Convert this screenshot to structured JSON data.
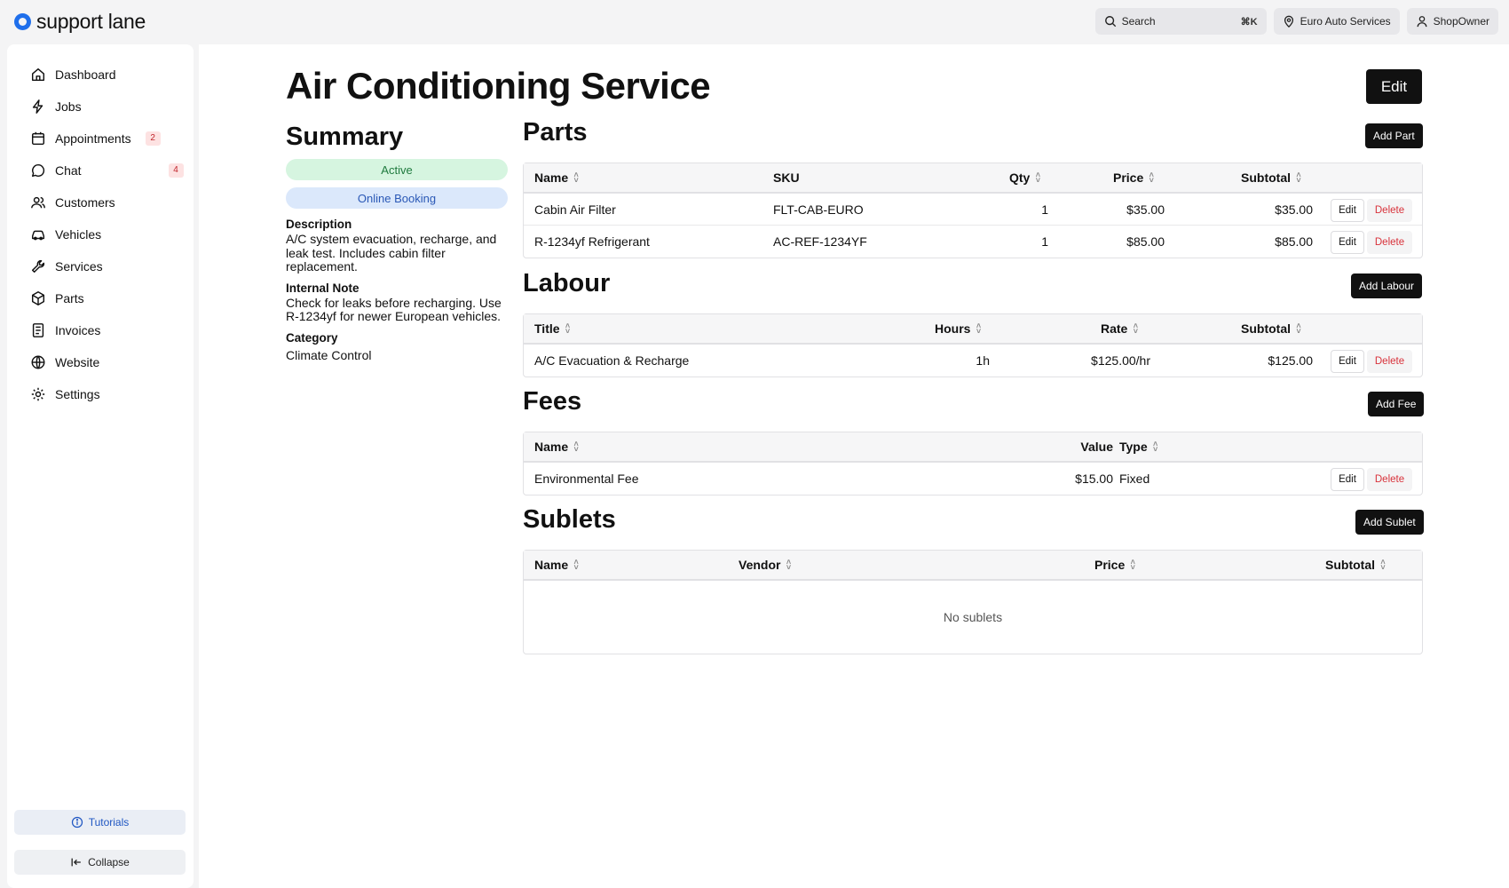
{
  "app": {
    "name": "support lane"
  },
  "topbar": {
    "search_label": "Search",
    "search_shortcut": "⌘K",
    "location": "Euro Auto Services",
    "user": "ShopOwner"
  },
  "sidebar": {
    "items": [
      {
        "label": "Dashboard",
        "icon": "home-icon"
      },
      {
        "label": "Jobs",
        "icon": "lightning-icon"
      },
      {
        "label": "Appointments",
        "icon": "calendar-icon",
        "badge": "2"
      },
      {
        "label": "Chat",
        "icon": "chat-icon",
        "badge": "4"
      },
      {
        "label": "Customers",
        "icon": "users-icon"
      },
      {
        "label": "Vehicles",
        "icon": "car-icon"
      },
      {
        "label": "Services",
        "icon": "wrench-icon"
      },
      {
        "label": "Parts",
        "icon": "box-icon"
      },
      {
        "label": "Invoices",
        "icon": "invoice-icon"
      },
      {
        "label": "Website",
        "icon": "globe-icon"
      },
      {
        "label": "Settings",
        "icon": "gear-icon"
      }
    ],
    "tutorials_label": "Tutorials",
    "collapse_label": "Collapse"
  },
  "page": {
    "title": "Air Conditioning Service",
    "edit_label": "Edit"
  },
  "summary": {
    "title": "Summary",
    "status_badge": "Active",
    "booking_badge": "Online Booking",
    "description_label": "Description",
    "description": "A/C system evacuation, recharge, and leak test. Includes cabin filter replacement.",
    "internal_note_label": "Internal Note",
    "internal_note": "Check for leaks before recharging. Use R-1234yf for newer European vehicles.",
    "category_label": "Category",
    "category": "Climate Control"
  },
  "parts": {
    "title": "Parts",
    "add_label": "Add Part",
    "columns": [
      "Name",
      "SKU",
      "Qty",
      "Price",
      "Subtotal"
    ],
    "rows": [
      {
        "name": "Cabin Air Filter",
        "sku": "FLT-CAB-EURO",
        "qty": "1",
        "price": "$35.00",
        "subtotal": "$35.00"
      },
      {
        "name": "R-1234yf Refrigerant",
        "sku": "AC-REF-1234YF",
        "qty": "1",
        "price": "$85.00",
        "subtotal": "$85.00"
      }
    ]
  },
  "labour": {
    "title": "Labour",
    "add_label": "Add Labour",
    "columns": [
      "Title",
      "Hours",
      "Rate",
      "Subtotal"
    ],
    "rows": [
      {
        "title": "A/C Evacuation & Recharge",
        "hours": "1h",
        "rate": "$125.00/hr",
        "subtotal": "$125.00"
      }
    ]
  },
  "fees": {
    "title": "Fees",
    "add_label": "Add Fee",
    "columns": [
      "Name",
      "Value",
      "Type"
    ],
    "rows": [
      {
        "name": "Environmental Fee",
        "value": "$15.00",
        "type": "Fixed"
      }
    ]
  },
  "sublets": {
    "title": "Sublets",
    "add_label": "Add Sublet",
    "columns": [
      "Name",
      "Vendor",
      "Price",
      "Subtotal"
    ],
    "empty_text": "No sublets"
  },
  "row_actions": {
    "edit": "Edit",
    "delete": "Delete"
  }
}
